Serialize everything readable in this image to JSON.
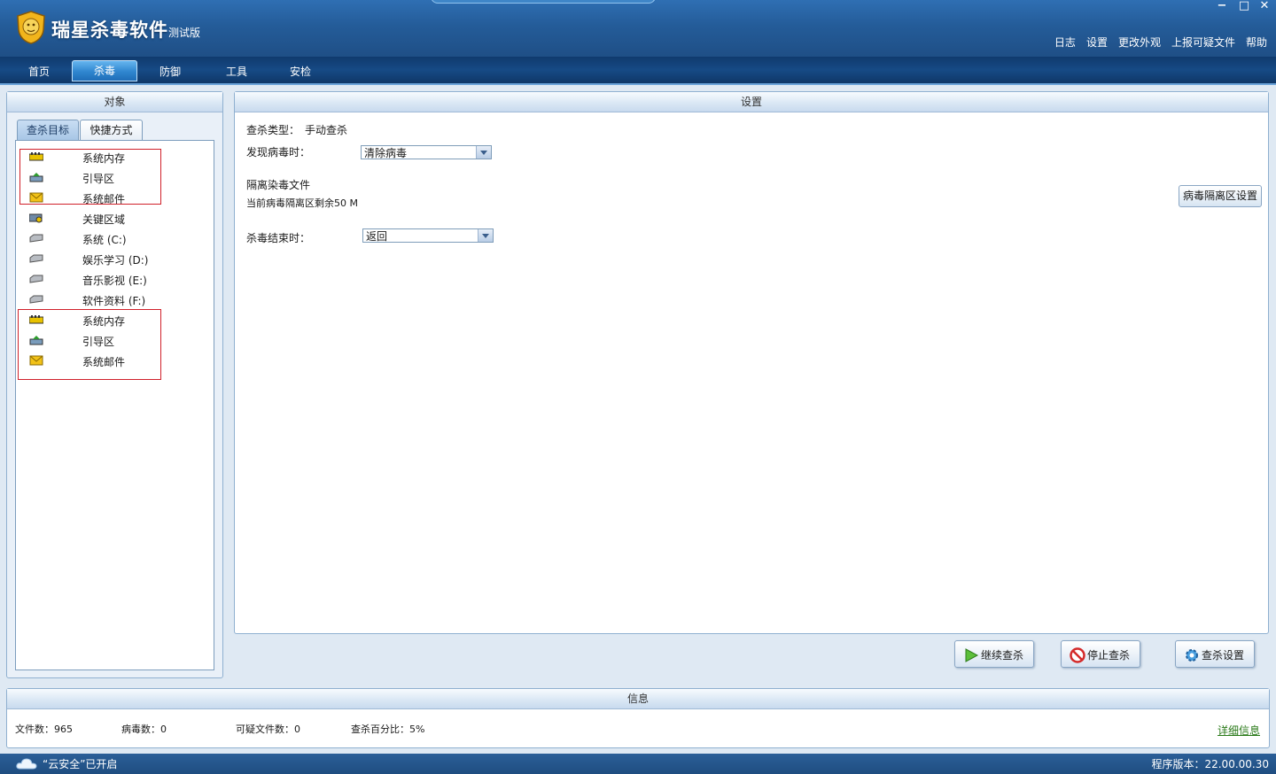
{
  "app": {
    "title": "瑞星杀毒软件",
    "subtitle": "测试版"
  },
  "window_controls": {
    "minimize": "−",
    "maximize": "□",
    "close": "✕"
  },
  "top_links": [
    "日志",
    "设置",
    "更改外观",
    "上报可疑文件",
    "帮助"
  ],
  "nav": {
    "tabs": [
      "首页",
      "杀毒",
      "防御",
      "工具",
      "安检"
    ],
    "active": "杀毒"
  },
  "left_panel": {
    "title": "对象",
    "tabs": [
      "查杀目标",
      "快捷方式"
    ],
    "items": [
      {
        "icon": "memory-icon",
        "label": "系统内存"
      },
      {
        "icon": "boot-icon",
        "label": "引导区"
      },
      {
        "icon": "mail-icon",
        "label": "系统邮件"
      },
      {
        "icon": "key-area-icon",
        "label": "关键区域"
      },
      {
        "icon": "drive-icon",
        "label": "系统 (C:)"
      },
      {
        "icon": "drive-icon",
        "label": "娱乐学习 (D:)"
      },
      {
        "icon": "drive-icon",
        "label": "音乐影视 (E:)"
      },
      {
        "icon": "drive-icon",
        "label": "软件资料 (F:)"
      },
      {
        "icon": "memory-icon",
        "label": "系统内存"
      },
      {
        "icon": "boot-icon",
        "label": "引导区"
      },
      {
        "icon": "mail-icon",
        "label": "系统邮件"
      }
    ]
  },
  "settings": {
    "title": "设置",
    "scan_type_label": "查杀类型：",
    "scan_type_value": "手动查杀",
    "on_virus_label": "发现病毒时：",
    "on_virus_value": "清除病毒",
    "quarantine_title": "隔离染毒文件",
    "quarantine_remaining": "当前病毒隔离区剩余50 M",
    "quarantine_button": "病毒隔离区设置",
    "on_finish_label": "杀毒结束时：",
    "on_finish_value": "返回"
  },
  "actions": {
    "continue": "继续查杀",
    "stop": "停止查杀",
    "settings": "查杀设置"
  },
  "info": {
    "title": "信息",
    "files_label": "文件数：",
    "files": "965",
    "virus_label": "病毒数：",
    "virus": "0",
    "suspicious_label": "可疑文件数：",
    "suspicious": "0",
    "percent_label": "查杀百分比：",
    "percent": "5%",
    "detail_link": "详细信息"
  },
  "status": {
    "cloud": "“云安全”已开启",
    "version_label": "程序版本：",
    "version": "22.00.00.30"
  },
  "colors": {
    "accent": "#245c99",
    "highlight_box": "#d0202a",
    "link": "#2a7a19"
  }
}
